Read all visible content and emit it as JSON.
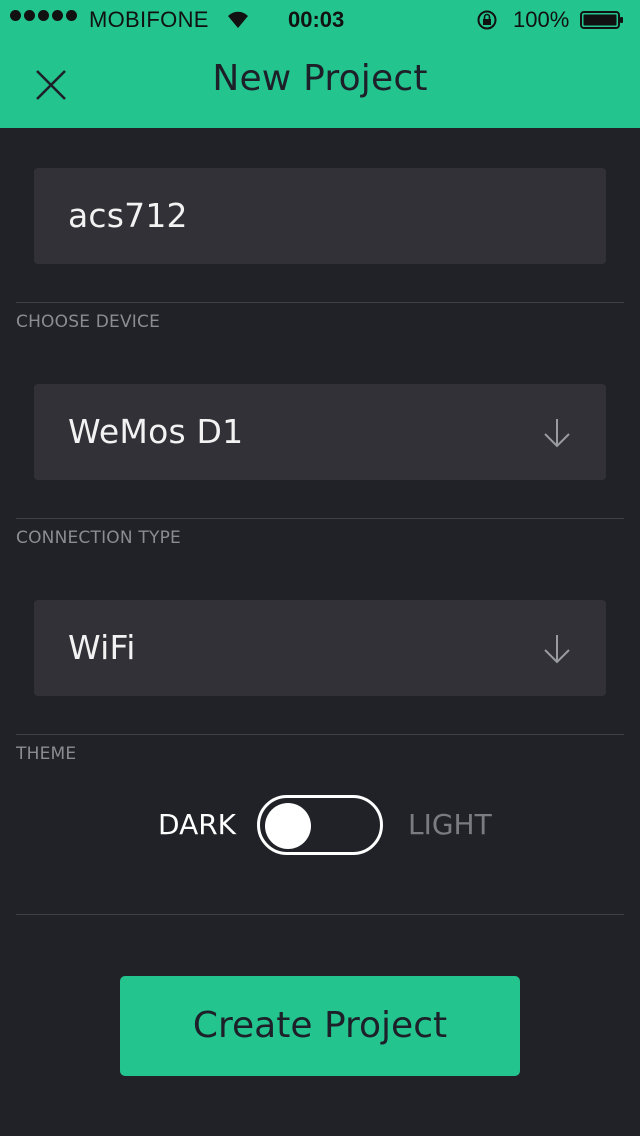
{
  "status_bar": {
    "carrier": "MOBIFONE",
    "time": "00:03",
    "battery": "100%"
  },
  "header": {
    "title": "New Project",
    "close_icon": "close-icon"
  },
  "project_name": {
    "value": "acs712"
  },
  "device": {
    "section_label": "CHOOSE DEVICE",
    "value": "WeMos D1",
    "icon": "arrow-down-icon"
  },
  "connection": {
    "section_label": "CONNECTION TYPE",
    "value": "WiFi",
    "icon": "arrow-down-icon"
  },
  "theme": {
    "section_label": "THEME",
    "dark_label": "DARK",
    "light_label": "LIGHT",
    "selected": "DARK"
  },
  "create_button": {
    "label": "Create Project"
  },
  "colors": {
    "accent": "#23c48e",
    "background": "#212227",
    "field": "#313137"
  }
}
